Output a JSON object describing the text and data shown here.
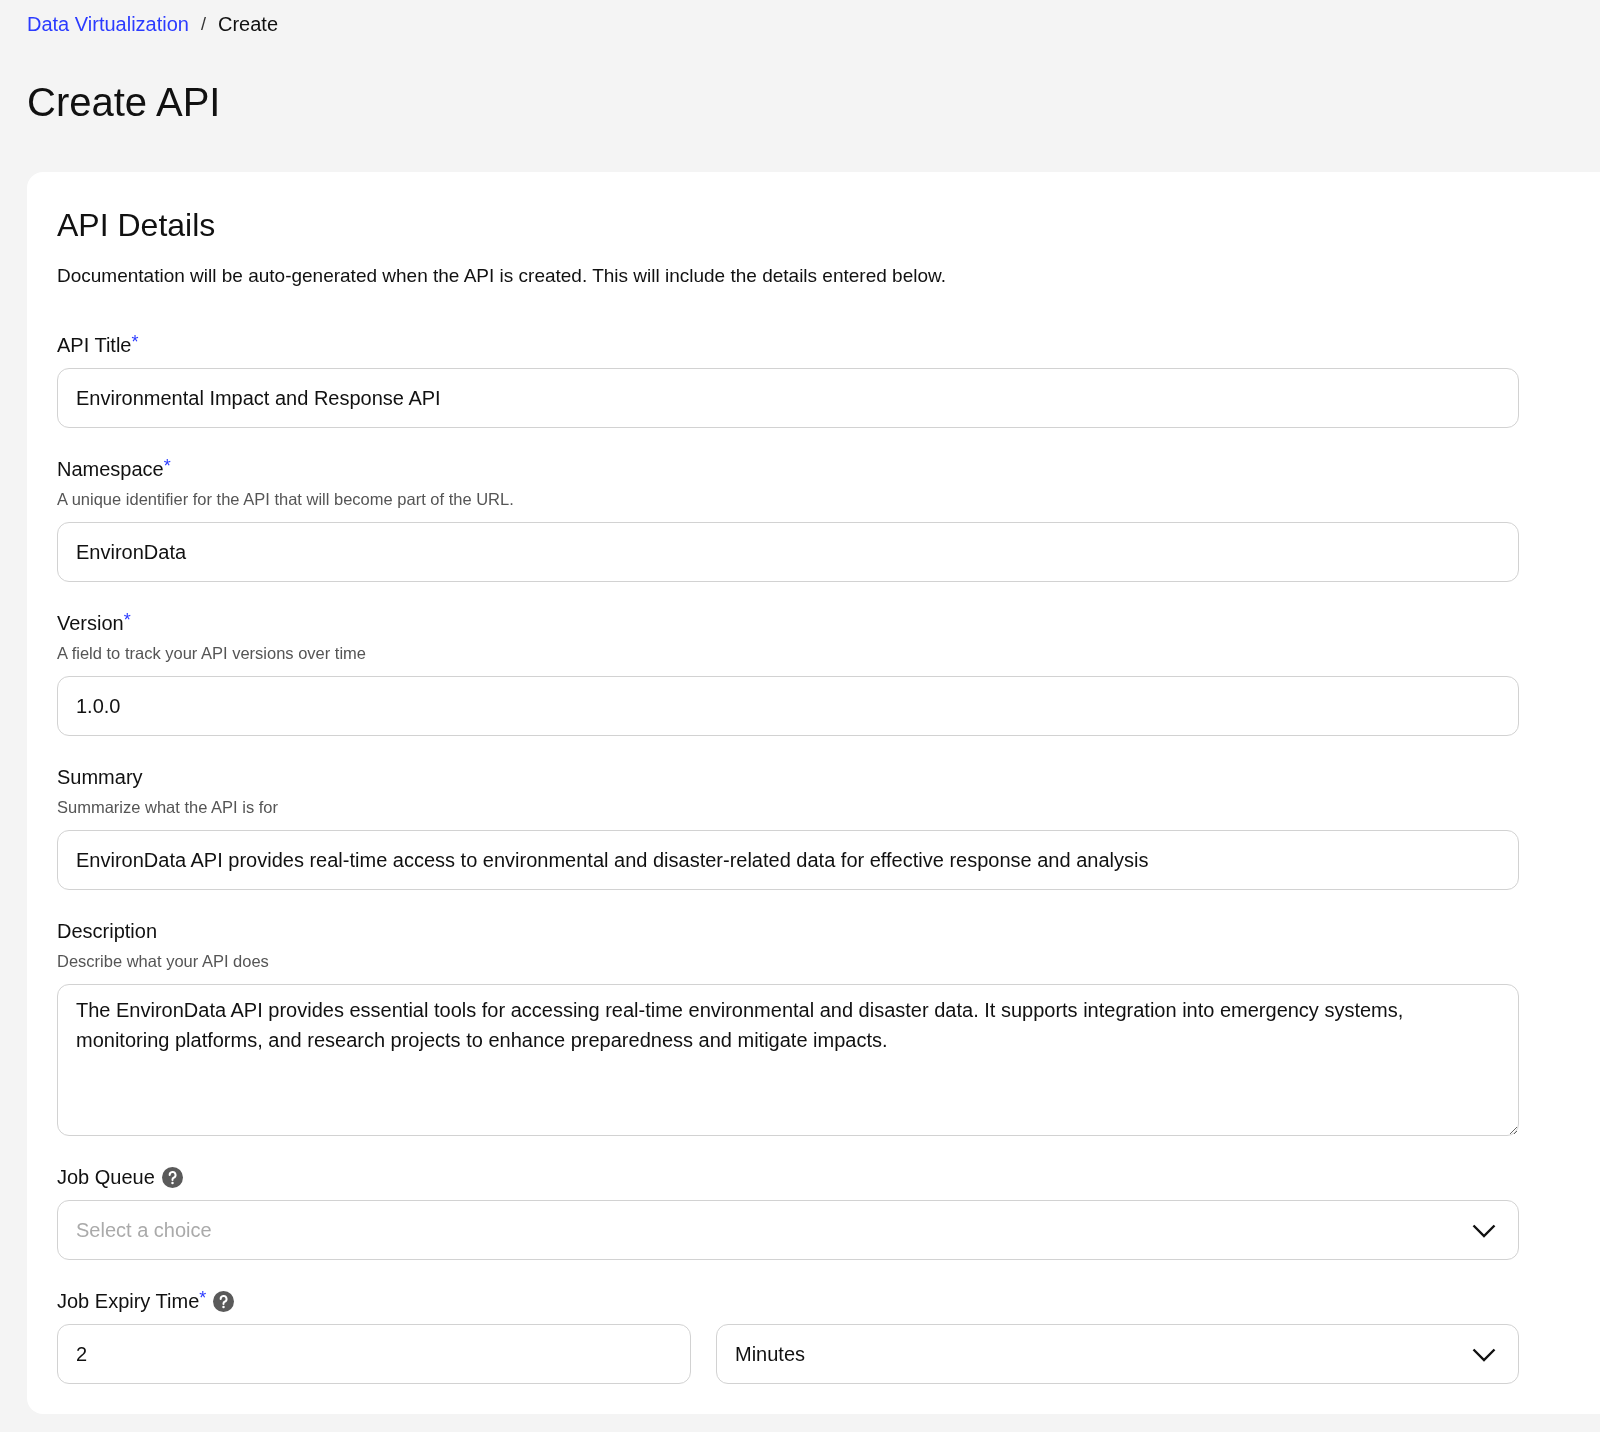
{
  "breadcrumb": [
    {
      "label": "Data Virtualization",
      "link": true
    },
    {
      "label": "Create",
      "link": false
    }
  ],
  "breadcrumb_separator": "/",
  "page_title": "Create API",
  "section": {
    "title": "API Details",
    "description": "Documentation will be auto-generated when the API is created. This will include the details entered below.",
    "fields": [
      {
        "kind": "text",
        "label": "API Title",
        "required_mark": "*",
        "value": "Environmental Impact and Response API"
      },
      {
        "kind": "text",
        "label": "Namespace",
        "required_mark": "*",
        "help": "A unique identifier for the API that will become part of the URL.",
        "value": "EnvironData"
      },
      {
        "kind": "text",
        "label": "Version",
        "required_mark": "*",
        "help": "A field to track your API versions over time",
        "value": "1.0.0"
      },
      {
        "kind": "text",
        "label": "Summary",
        "help": "Summarize what the API is for",
        "value": "EnvironData API provides real-time access to environmental and disaster-related data for effective response and analysis"
      },
      {
        "kind": "textarea",
        "label": "Description",
        "help": "Describe what your API does",
        "value": "The EnvironData API provides essential tools for accessing real-time environmental and disaster data. It supports integration into emergency systems, monitoring platforms, and research projects to enhance preparedness and mitigate impacts."
      },
      {
        "kind": "select",
        "label": "Job Queue",
        "info": true,
        "placeholder": "Select a choice"
      },
      {
        "kind": "split",
        "label": "Job Expiry Time",
        "required_mark": "*",
        "info": true,
        "value": "2",
        "unit": "Minutes"
      }
    ]
  }
}
